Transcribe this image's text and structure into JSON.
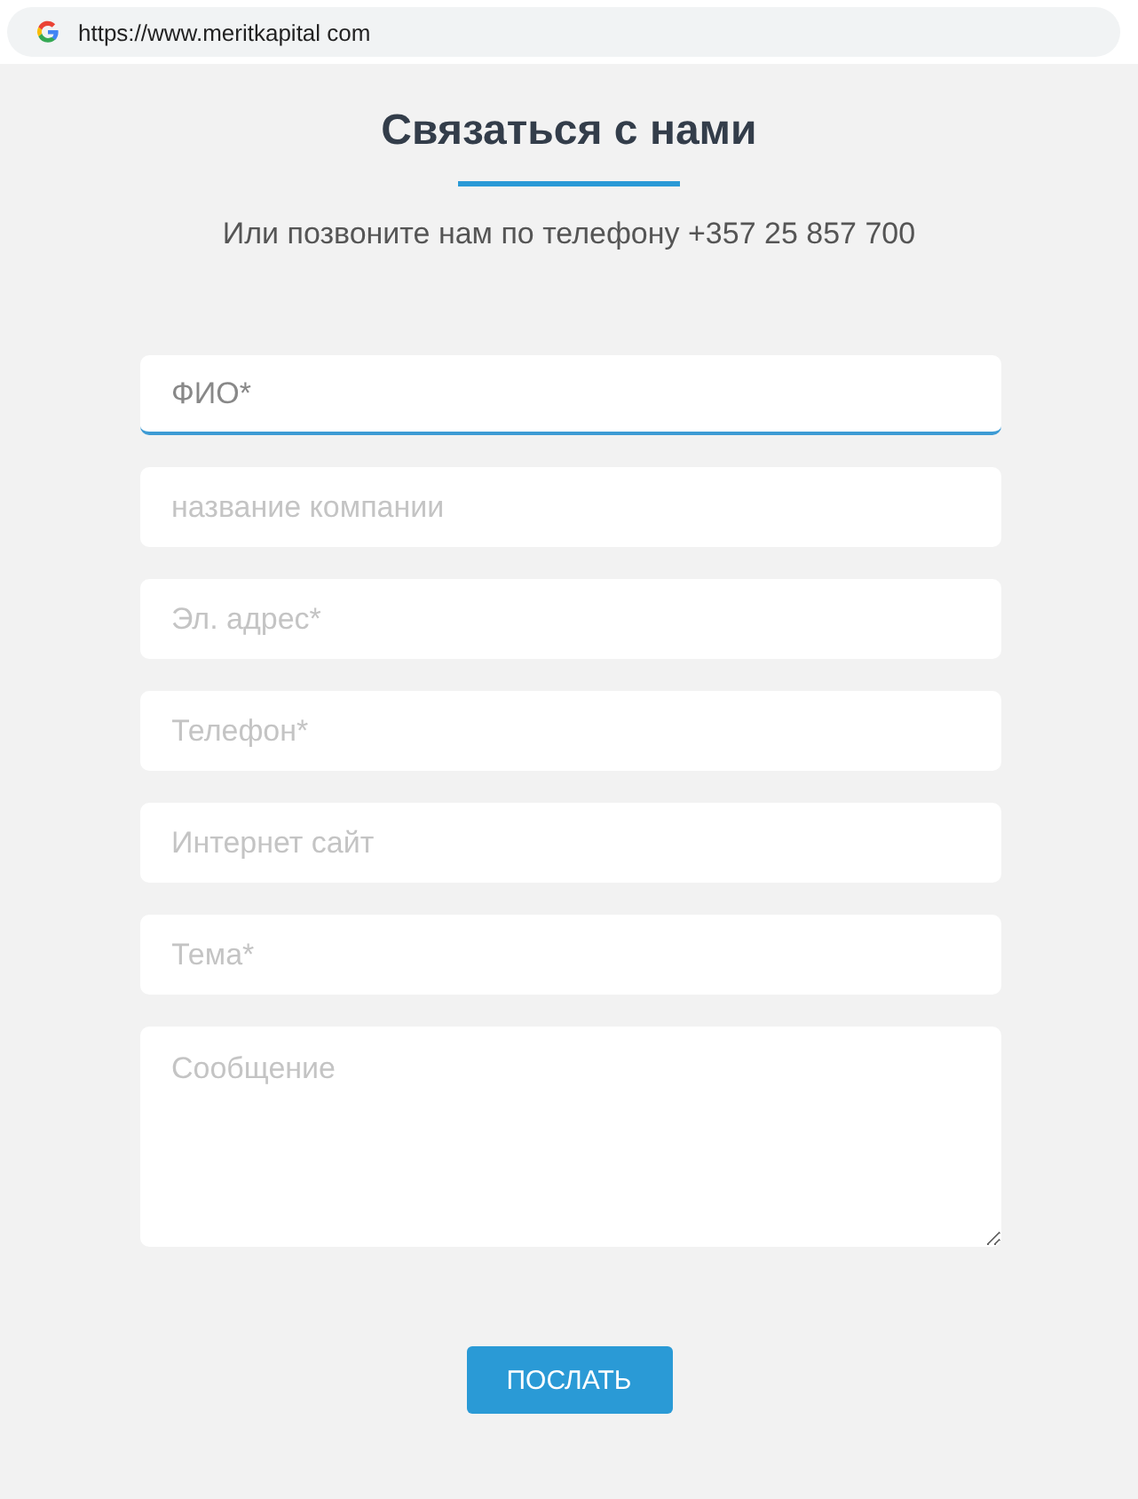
{
  "address_bar": {
    "url": "https://www.meritkapital com"
  },
  "title": "Связаться с нами",
  "subtitle": "Или позвоните нам по телефону +357 25 857 700",
  "fields": [
    {
      "kind": "input",
      "placeholder": "ФИО*",
      "focused": true
    },
    {
      "kind": "input",
      "placeholder": "название компании",
      "focused": false
    },
    {
      "kind": "input",
      "placeholder": "Эл. адрес*",
      "focused": false
    },
    {
      "kind": "input",
      "placeholder": "Телефон*",
      "focused": false
    },
    {
      "kind": "input",
      "placeholder": "Интернет сайт",
      "focused": false
    },
    {
      "kind": "input",
      "placeholder": "Тема*",
      "focused": false
    },
    {
      "kind": "textarea",
      "placeholder": "Сообщение",
      "focused": false
    }
  ],
  "submit_button": "ПОСЛАТЬ"
}
